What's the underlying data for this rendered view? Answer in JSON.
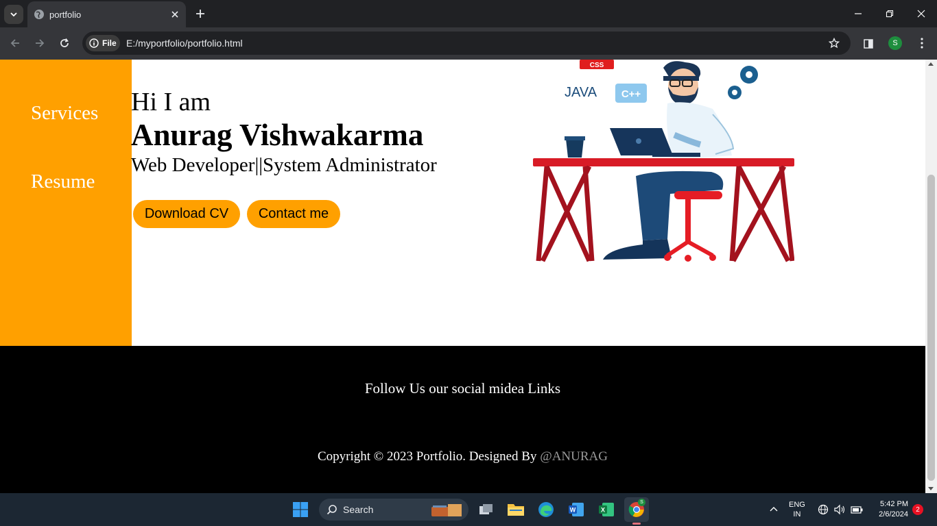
{
  "browser": {
    "tab_title": "portfolio",
    "file_chip": "File",
    "url": "E:/myportfolio/portfolio.html",
    "profile_initial": "S"
  },
  "page": {
    "sidebar": {
      "links": [
        {
          "label": "Services"
        },
        {
          "label": "Resume"
        }
      ]
    },
    "hero": {
      "greeting": "Hi I am",
      "name": "Anurag Vishwakarma",
      "role": "Web Developer||System Administrator",
      "buttons": [
        {
          "label": "Download CV"
        },
        {
          "label": "Contact me"
        }
      ],
      "illustration_labels": {
        "css": "CSS",
        "java": "JAVA",
        "cpp": "C++"
      }
    },
    "footer": {
      "follow": "Follow Us our social midea Links",
      "copyright_prefix": "Copyright © 2023 Portfolio. Designed By",
      "copyright_author": "@ANURAG"
    }
  },
  "taskbar": {
    "search_label": "Search",
    "lang_line1": "ENG",
    "lang_line2": "IN",
    "time": "5:42 PM",
    "date": "2/6/2024",
    "notification_count": "2"
  },
  "colors": {
    "accent": "#ffa000",
    "footer_bg": "#000000",
    "chrome_dark": "#202124",
    "chrome_toolbar": "#35363a"
  }
}
